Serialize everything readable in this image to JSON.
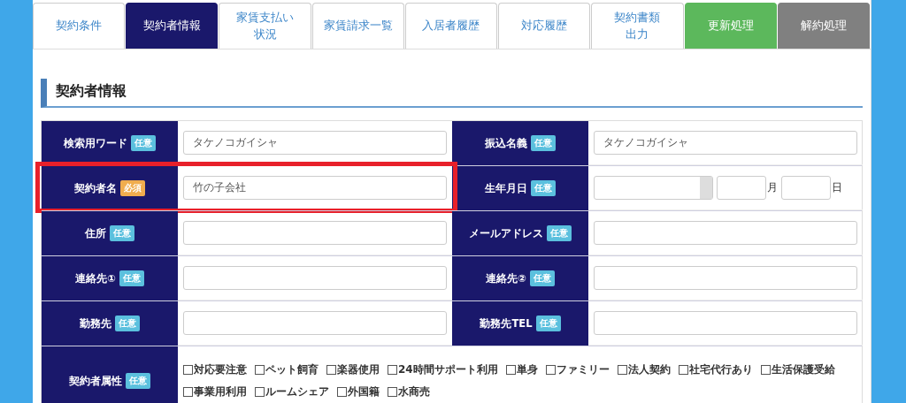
{
  "tabs": [
    {
      "label": "契約条件",
      "kind": "tab",
      "selected": false
    },
    {
      "label": "契約者情報",
      "kind": "tab",
      "selected": true
    },
    {
      "lines": [
        "家賃支払い",
        "状況"
      ],
      "kind": "tab",
      "selected": false
    },
    {
      "label": "家賃請求一覧",
      "kind": "tab",
      "selected": false
    },
    {
      "label": "入居者履歴",
      "kind": "tab",
      "selected": false
    },
    {
      "label": "対応履歴",
      "kind": "tab",
      "selected": false
    },
    {
      "lines": [
        "契約書類",
        "出力"
      ],
      "kind": "tab",
      "selected": false
    },
    {
      "label": "更新処理",
      "kind": "renew"
    },
    {
      "label": "解約処理",
      "kind": "cancel"
    }
  ],
  "section_title": "契約者情報",
  "rows": [
    {
      "highlighted": false,
      "cells": [
        {
          "label": "検索用ワード",
          "badge": "任意",
          "required": false,
          "kind": "text",
          "value": "タケノコガイシャ"
        },
        {
          "label": "振込名義",
          "badge": "任意",
          "required": false,
          "kind": "text",
          "value": "タケノコガイシャ"
        }
      ]
    },
    {
      "highlighted": true,
      "cells": [
        {
          "label": "契約者名",
          "badge": "必須",
          "required": true,
          "kind": "text",
          "value": "竹の子会社"
        },
        {
          "label": "生年月日",
          "badge": "任意",
          "required": false,
          "kind": "date",
          "month_unit": "月",
          "day_unit": "日"
        }
      ]
    },
    {
      "highlighted": false,
      "cells": [
        {
          "label": "住所",
          "badge": "任意",
          "required": false,
          "kind": "text"
        },
        {
          "label": "メールアドレス",
          "badge": "任意",
          "required": false,
          "kind": "text"
        }
      ]
    },
    {
      "highlighted": false,
      "cells": [
        {
          "label": "連絡先①",
          "badge": "任意",
          "required": false,
          "kind": "text"
        },
        {
          "label": "連絡先②",
          "badge": "任意",
          "required": false,
          "kind": "text"
        }
      ]
    },
    {
      "highlighted": false,
      "cells": [
        {
          "label": "勤務先",
          "badge": "任意",
          "required": false,
          "kind": "text"
        },
        {
          "label": "勤務先TEL",
          "badge": "任意",
          "required": false,
          "kind": "text"
        }
      ]
    },
    {
      "highlighted": false,
      "cells": [
        {
          "label": "契約者属性",
          "badge": "任意",
          "required": false,
          "kind": "checkboxes",
          "options": [
            {
              "label": "対応要注意",
              "checked": false
            },
            {
              "label": "ペット飼育",
              "checked": false
            },
            {
              "label": "楽器使用",
              "checked": false
            },
            {
              "label": "24時間サポート利用",
              "checked": false
            },
            {
              "label": "単身",
              "checked": false
            },
            {
              "label": "ファミリー",
              "checked": false
            },
            {
              "label": "法人契約",
              "checked": false
            },
            {
              "label": "社宅代行あり",
              "checked": false
            },
            {
              "label": "生活保護受給",
              "checked": false
            },
            {
              "label": "事業用利用",
              "checked": false
            },
            {
              "label": "ルームシェア",
              "checked": false
            },
            {
              "label": "外国籍",
              "checked": false
            },
            {
              "label": "水商売",
              "checked": false
            }
          ]
        }
      ]
    }
  ]
}
